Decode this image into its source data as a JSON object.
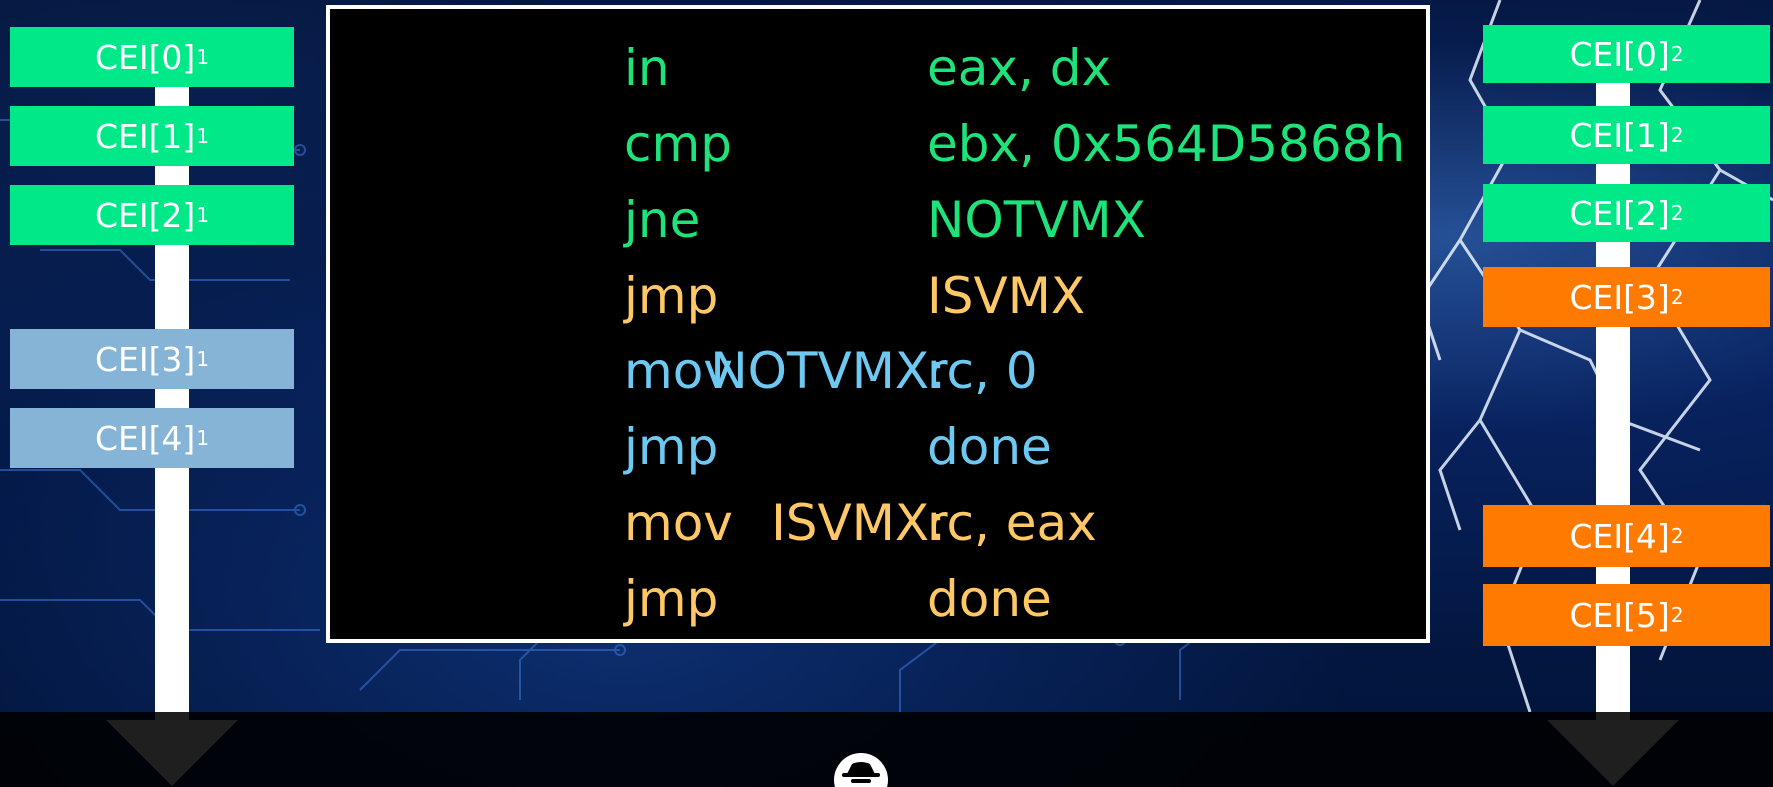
{
  "colors": {
    "green": "#00e888",
    "blue": "#85b4d6",
    "orange": "#ff7a00",
    "code_green": "#1ee37a",
    "code_blue": "#6ec9f2",
    "code_orange": "#ffc867"
  },
  "left_column": [
    {
      "base": "CEI[0]",
      "sub": "1"
    },
    {
      "base": "CEI[1]",
      "sub": "1"
    },
    {
      "base": "CEI[2]",
      "sub": "1"
    },
    {
      "base": "CEI[3]",
      "sub": "1"
    },
    {
      "base": "CEI[4]",
      "sub": "1"
    }
  ],
  "right_column": [
    {
      "base": "CEI[0]",
      "sub": "2"
    },
    {
      "base": "CEI[1]",
      "sub": "2"
    },
    {
      "base": "CEI[2]",
      "sub": "2"
    },
    {
      "base": "CEI[3]",
      "sub": "2"
    },
    {
      "base": "CEI[4]",
      "sub": "2"
    },
    {
      "base": "CEI[5]",
      "sub": "2"
    }
  ],
  "code": [
    {
      "label": "",
      "mnemonic": "in",
      "operands": "eax, dx"
    },
    {
      "label": "",
      "mnemonic": "cmp",
      "operands": "ebx, 0x564D5868h"
    },
    {
      "label": "",
      "mnemonic": "jne",
      "operands": "NOTVMX"
    },
    {
      "label": "",
      "mnemonic": "jmp",
      "operands": "ISVMX"
    },
    {
      "label": "NOTVMX:",
      "mnemonic": "mov",
      "operands": "rc, 0"
    },
    {
      "label": "",
      "mnemonic": "jmp",
      "operands": "done"
    },
    {
      "label": "ISVMX:",
      "mnemonic": "mov",
      "operands": "rc, eax"
    },
    {
      "label": "",
      "mnemonic": "jmp",
      "operands": "done"
    }
  ],
  "logo_icon": "spy-hat-icon"
}
